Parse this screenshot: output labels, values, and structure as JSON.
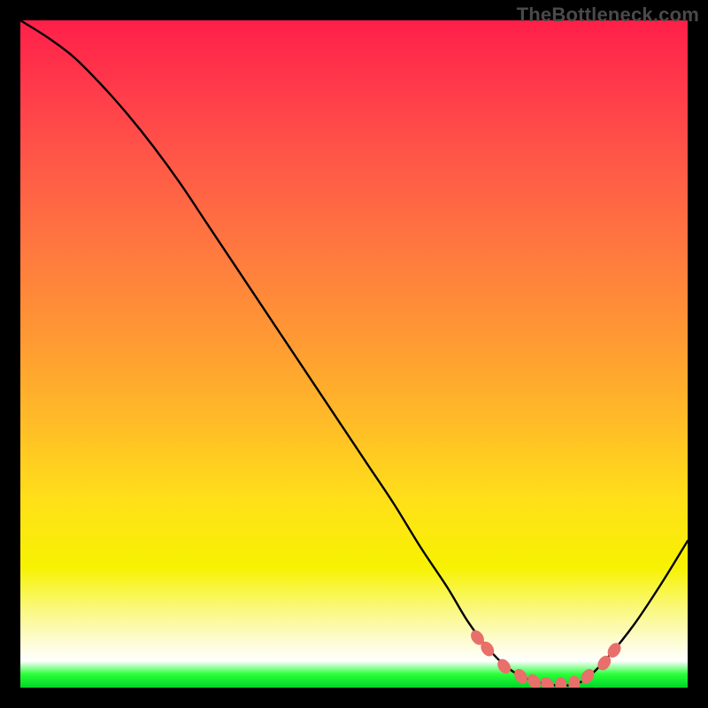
{
  "watermark": "TheBottleneck.com",
  "chart_data": {
    "type": "line",
    "title": "",
    "xlabel": "",
    "ylabel": "",
    "xlim": [
      0,
      100
    ],
    "ylim": [
      0,
      100
    ],
    "series": [
      {
        "name": "bottleneck-curve",
        "x": [
          0,
          4,
          8,
          12,
          16,
          20,
          24,
          28,
          32,
          36,
          40,
          44,
          48,
          52,
          56,
          60,
          64,
          67,
          70,
          73,
          76,
          79,
          81,
          83,
          85,
          88,
          92,
          96,
          100
        ],
        "y": [
          100,
          97.5,
          94.5,
          90.5,
          86,
          81,
          75.5,
          69.5,
          63.5,
          57.5,
          51.5,
          45.5,
          39.5,
          33.5,
          27.5,
          21.0,
          15.0,
          10.0,
          6.0,
          3.0,
          1.3,
          0.5,
          0.3,
          0.5,
          1.5,
          4.5,
          9.5,
          15.5,
          22.0
        ]
      }
    ],
    "markers": {
      "name": "beads",
      "points": [
        {
          "x": 68.5,
          "y": 7.5
        },
        {
          "x": 70.0,
          "y": 5.8
        },
        {
          "x": 72.5,
          "y": 3.2
        },
        {
          "x": 75.0,
          "y": 1.7
        },
        {
          "x": 77.0,
          "y": 0.9
        },
        {
          "x": 79.0,
          "y": 0.5
        },
        {
          "x": 81.0,
          "y": 0.4
        },
        {
          "x": 83.0,
          "y": 0.6
        },
        {
          "x": 85.0,
          "y": 1.7
        },
        {
          "x": 87.5,
          "y": 3.7
        },
        {
          "x": 89.0,
          "y": 5.6
        }
      ]
    },
    "gradient_stops": [
      {
        "pct": 0,
        "color": "#ff1f49"
      },
      {
        "pct": 60,
        "color": "#ffbb28"
      },
      {
        "pct": 82,
        "color": "#f7f201"
      },
      {
        "pct": 96,
        "color": "#ffffff"
      },
      {
        "pct": 100,
        "color": "#00d428"
      }
    ]
  }
}
